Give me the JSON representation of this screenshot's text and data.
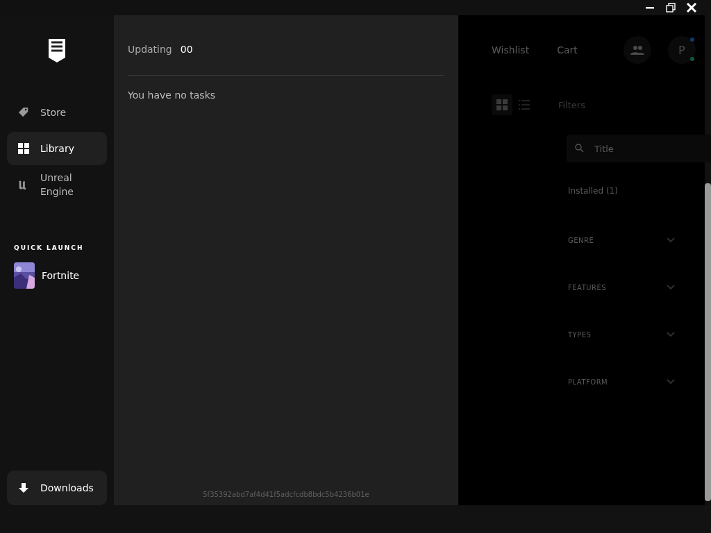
{
  "sidebar": {
    "nav": [
      {
        "kind": "store",
        "label": "Store",
        "selected": false
      },
      {
        "kind": "library",
        "label": "Library",
        "selected": true
      },
      {
        "kind": "unreal",
        "label": "Unreal Engine",
        "selected": false
      }
    ],
    "quick_launch": {
      "heading": "QUICK LAUNCH",
      "items": [
        {
          "label": "Fortnite"
        }
      ]
    },
    "downloads": {
      "label": "Downloads"
    }
  },
  "downloads_panel": {
    "status_label": "Updating",
    "status_count": "00",
    "empty_message": "You have no tasks",
    "footer_id": "5f35392abd7af4d41f5adcfcdb8bdc5b4236b01e"
  },
  "store_panel": {
    "top_links": [
      "Wishlist",
      "Cart"
    ],
    "avatar_initial": "P",
    "filters_label": "Filters",
    "search": {
      "placeholder": "Title"
    },
    "installed": "Installed (1)",
    "filter_groups": [
      {
        "label": "GENRE",
        "expanded": false
      },
      {
        "label": "FEATURES",
        "expanded": false
      },
      {
        "label": "TYPES",
        "expanded": false
      },
      {
        "label": "PLATFORM",
        "expanded": false
      }
    ]
  }
}
